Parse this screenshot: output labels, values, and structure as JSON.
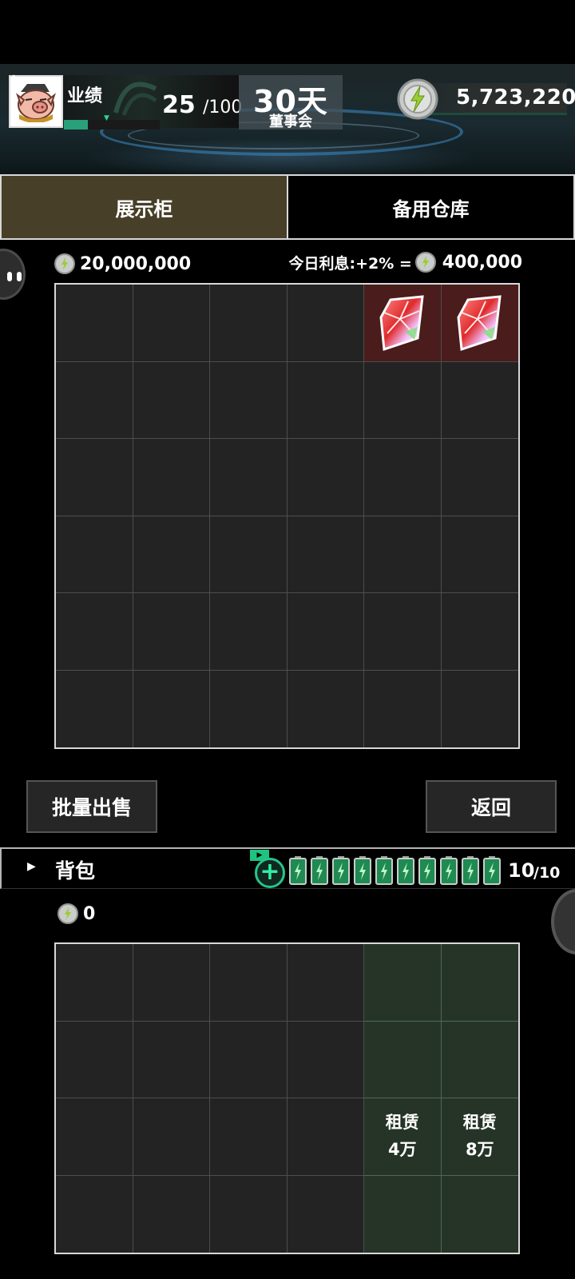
{
  "header": {
    "performance_label": "业绩",
    "performance_value": "25",
    "performance_max": "/100",
    "performance_progress": 0.25,
    "days_value": "30天",
    "days_sub": "董事会",
    "money": "5,723,220"
  },
  "tabs": [
    {
      "label": "展示柜",
      "active": true
    },
    {
      "label": "备用仓库",
      "active": false
    }
  ],
  "showcase": {
    "balance": "20,000,000",
    "interest_label": "今日利息:+2% =",
    "interest_value": "400,000",
    "rows": 6,
    "cols": 6,
    "items": [
      {
        "row": 0,
        "col": 4,
        "type": "gem-icon"
      },
      {
        "row": 0,
        "col": 5,
        "type": "gem-icon"
      }
    ]
  },
  "actions": {
    "bulk_sell": "批量出售",
    "back": "返回"
  },
  "backpack": {
    "title": "背包",
    "energy_value": "10",
    "energy_max": "/10",
    "battery_count": 10,
    "balance": "0",
    "rows": 4,
    "cols": 6,
    "rent_slots": [
      {
        "row": 2,
        "col": 4,
        "label": "租赁",
        "price": "4万"
      },
      {
        "row": 2,
        "col": 5,
        "label": "租赁",
        "price": "8万"
      }
    ]
  },
  "colors": {
    "accent_green": "#2aa07a",
    "tab_active": "#483f28",
    "occupied_cell": "#4a1c1c",
    "rent_cell": "#263428"
  }
}
